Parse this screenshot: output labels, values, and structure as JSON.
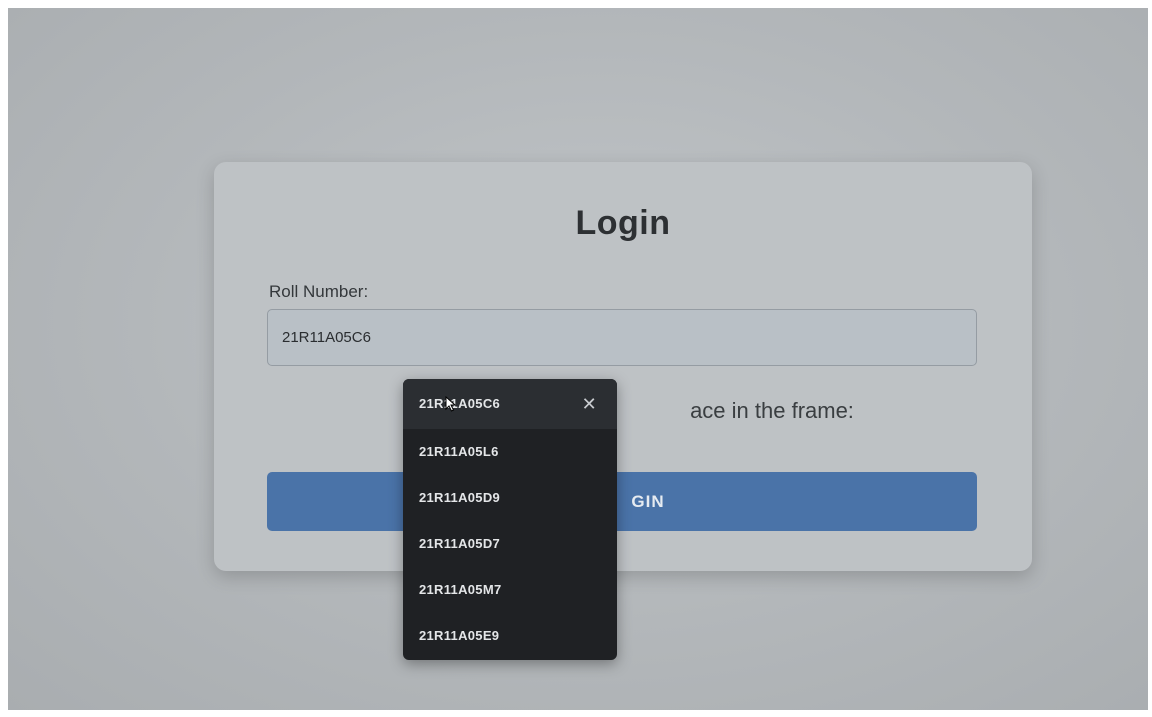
{
  "login": {
    "title": "Login",
    "roll_label": "Roll Number:",
    "roll_value": "21R11A05C6",
    "capture_text_visible": "ace in the frame:",
    "button_text_visible": "GIN"
  },
  "autocomplete": {
    "remove_icon": "close-icon",
    "options": [
      "21R11A05C6",
      "21R11A05L6",
      "21R11A05D9",
      "21R11A05D7",
      "21R11A05M7",
      "21R11A05E9"
    ]
  },
  "colors": {
    "button": "#4a73a8",
    "dropdown_bg": "#1f2124",
    "card_bg": "#bec2c5"
  }
}
